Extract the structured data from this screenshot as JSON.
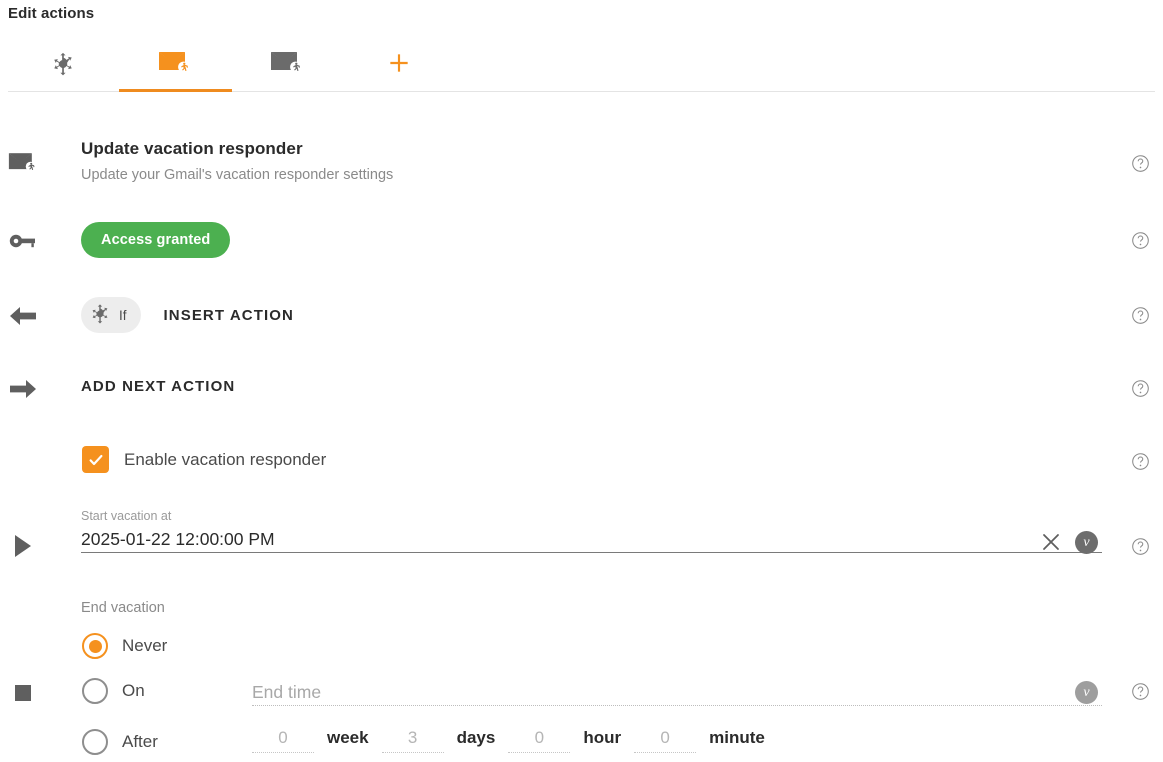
{
  "header": {
    "title": "Edit actions"
  },
  "tabs": [
    {
      "icon": "branch-icon",
      "state": "inactive",
      "name": "tab-branch"
    },
    {
      "icon": "mail-runner-icon",
      "state": "active",
      "name": "tab-mail-action-1"
    },
    {
      "icon": "mail-runner-icon",
      "state": "inactive",
      "name": "tab-mail-action-2"
    },
    {
      "icon": "plus-icon",
      "state": "add",
      "name": "tab-add"
    }
  ],
  "action": {
    "title": "Update vacation responder",
    "subtitle": "Update your Gmail's vacation responder settings",
    "access_badge": "Access granted",
    "insert_chip_label": "If",
    "insert_action_label": "INSERT ACTION",
    "add_next_action_label": "ADD NEXT ACTION"
  },
  "form": {
    "enable_checkbox_label": "Enable vacation responder",
    "enable_checkbox_checked": true,
    "start": {
      "label": "Start vacation at",
      "value": "2025-01-22 12:00:00 PM",
      "clear_icon": "close-icon",
      "variable_badge": "v"
    },
    "end": {
      "label": "End vacation",
      "selected": "Never",
      "options": [
        {
          "label": "Never",
          "checked": true
        },
        {
          "label": "On",
          "checked": false
        },
        {
          "label": "After",
          "checked": false
        }
      ],
      "end_time_placeholder": "End time",
      "end_time_value": "",
      "variable_badge": "v",
      "duration": [
        {
          "value": "0",
          "unit": "week"
        },
        {
          "value": "3",
          "unit": "days"
        },
        {
          "value": "0",
          "unit": "hour"
        },
        {
          "value": "0",
          "unit": "minute"
        }
      ]
    }
  },
  "gutter_icons": [
    "mail-runner-icon",
    "key-icon",
    "arrow-left-icon",
    "arrow-right-icon",
    "play-icon",
    "stop-icon"
  ],
  "help_icons_count": 7,
  "colors": {
    "accent_orange": "#f5911e",
    "tab_underline": "#ef8b1f",
    "success_green": "#4cb050",
    "text_dark": "#2b2b2b",
    "text_muted": "#8a8a8a"
  }
}
